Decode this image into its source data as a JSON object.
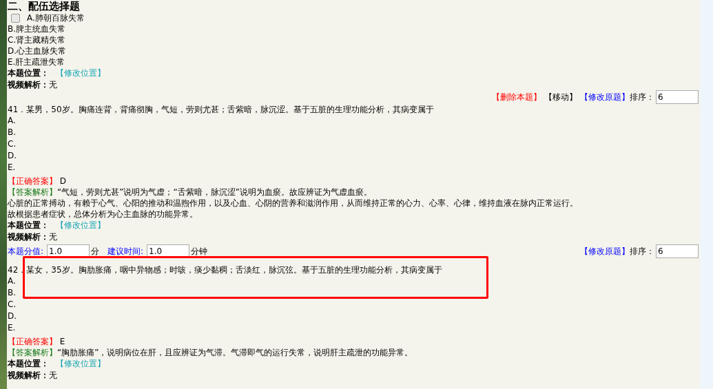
{
  "section_title": "二、配伍选择题",
  "blocks": [
    {
      "options": [
        {
          "label": "A.肺朝百脉失常",
          "checkbox": true,
          "checked": false
        },
        {
          "label": "B.脾主统血失常"
        },
        {
          "label": "C.肾主藏精失常"
        },
        {
          "label": "D.心主血脉失常"
        },
        {
          "label": "E.肝主疏泄失常"
        }
      ],
      "position": {
        "label": "本题位置：",
        "link": "【修改位置】"
      },
      "video": {
        "label": "视频解析：",
        "value": "无"
      }
    },
    {
      "actions": [
        {
          "label": "【删除本题】",
          "kind": "delete"
        },
        {
          "label": "【移动】",
          "kind": "move"
        },
        {
          "label": "【修改原题】",
          "kind": "edit"
        }
      ],
      "sort": {
        "label": "排序：",
        "value": "6"
      },
      "question": "41．某男，50岁。胸痛连背，背痛彻胸，气短，劳则尤甚；舌紫暗，脉沉涩。基于五脏的生理功能分析，其病变属于",
      "options": [
        {
          "label": "A."
        },
        {
          "label": "B."
        },
        {
          "label": "C."
        },
        {
          "label": "D."
        },
        {
          "label": "E."
        }
      ],
      "answer": {
        "label": "【正确答案】",
        "value": "D"
      },
      "analysis": [
        {
          "label": "【答案解析】",
          "text": "“气短，劳则尤甚”说明为气虚；“舌紫暗，脉沉涩”说明为血瘀。故应辨证为气虚血瘀。"
        },
        {
          "text": "心脏的正常搏动，有赖于心气、心阳的推动和温煦作用，以及心血、心阴的营养和滋润作用，从而维持正常的心力、心率、心律，维持血液在脉内正常运行。"
        },
        {
          "text": "故根据患者症状，总体分析为心主血脉的功能异常。"
        }
      ],
      "position": {
        "label": "本题位置：",
        "link": "【修改位置】"
      },
      "video": {
        "label": "视频解析：",
        "value": "无"
      },
      "score_row": {
        "score_label": "本题分值:",
        "score": "1.0",
        "score_unit": "分",
        "time_label": "建议时间:",
        "time": "1.0",
        "time_unit": "分钟",
        "edit": "【修改原题】",
        "sort_label": "排序：",
        "sort": "6"
      }
    },
    {
      "question": "42．某女，35岁。胸肋胀痛，咽中异物感；时咳，痰少黏稠；舌淡红，脉沉弦。基于五脏的生理功能分析，其病变属于",
      "options": [
        {
          "label": "A."
        },
        {
          "label": "B."
        },
        {
          "label": "C."
        },
        {
          "label": "D."
        },
        {
          "label": "E."
        }
      ],
      "answer": {
        "label": "【正确答案】",
        "value": "E"
      },
      "analysis": [
        {
          "label": "【答案解析】",
          "text": "“胸肋胀痛”，说明病位在肝，且应辨证为气滞。气滞即气的运行失常，说明肝主疏泄的功能异常。"
        }
      ],
      "position": {
        "label": "本题位置：",
        "link": "【修改位置】"
      },
      "video": {
        "label": "视频解析：",
        "value": "无"
      },
      "highlighted": true
    }
  ]
}
